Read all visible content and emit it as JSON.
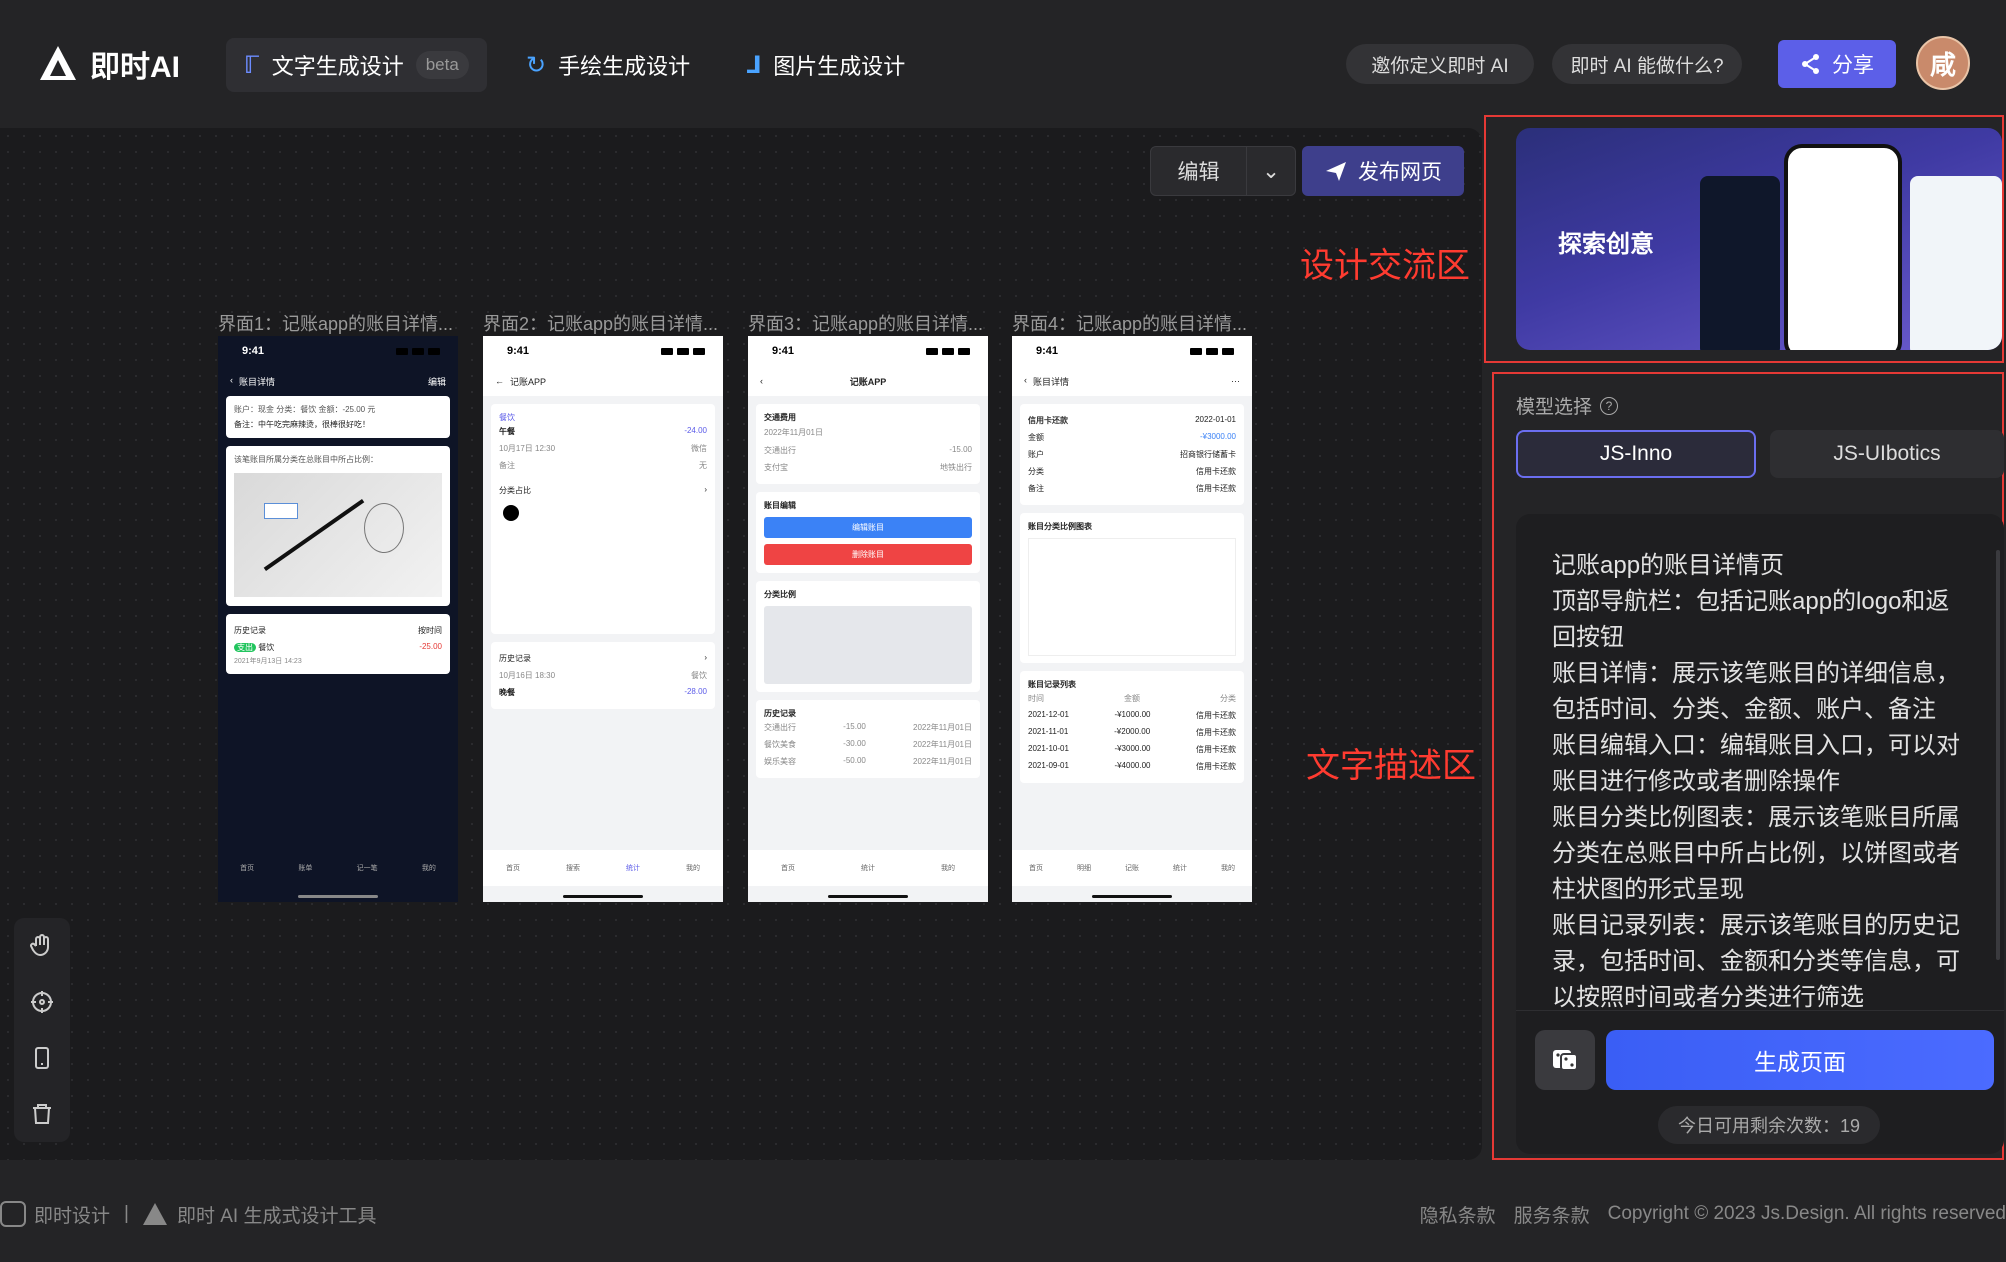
{
  "header": {
    "logo_text": "即时AI",
    "tabs": [
      {
        "label": "文字生成设计",
        "badge": "beta"
      },
      {
        "label": "手绘生成设计"
      },
      {
        "label": "图片生成设计"
      }
    ],
    "invite": "邀你定义即时 AI",
    "what_can": "即时 AI 能做什么?",
    "share": "分享",
    "avatar": "咸"
  },
  "canvas": {
    "edit": "编辑",
    "publish": "发布网页",
    "screens": [
      {
        "title": "界面1：记账app的账目详情..."
      },
      {
        "title": "界面2：记账app的账目详情..."
      },
      {
        "title": "界面3：记账app的账目详情..."
      },
      {
        "title": "界面4：记账app的账目详情..."
      }
    ],
    "phone1": {
      "time": "9:41",
      "title": "账目详情",
      "edit": "编辑",
      "info": "账户：现金  分类：餐饮  金额：-25.00 元",
      "note": "备注：中午吃完麻辣烫，很棒很好吃！",
      "chart_q": "该笔账目所属分类在总账目中所占比例：",
      "history": "历史记录",
      "sort": "按时间",
      "tag": "支出",
      "cat": "餐饮",
      "amt": "-25.00",
      "date": "2021年9月13日 14:23",
      "tabs": [
        "首页",
        "账单",
        "记一笔",
        "我的"
      ]
    },
    "phone2": {
      "time": "9:41",
      "title": "记账APP",
      "cat": "餐饮",
      "item": "午餐",
      "amt": "-24.00",
      "date": "10月17日 12:30",
      "note": "备注",
      "pay": "微信",
      "none": "无",
      "pie": "分类占比",
      "history": "历史记录",
      "date2": "10月16日 18:30",
      "cat2": "餐饮",
      "item2": "晚餐",
      "amt2": "-28.00",
      "tabs": [
        "首页",
        "搜索",
        "统计",
        "我的"
      ]
    },
    "phone3": {
      "time": "9:41",
      "title": "记账APP",
      "fee": "交通费用",
      "date": "2022年11月01日",
      "k1": "交通出行",
      "v1": "-15.00",
      "k2": "支付宝",
      "v2": "地铁出行",
      "edit": "账目编辑",
      "btn1": "编辑账目",
      "btn2": "删除账目",
      "ratio": "分类比例",
      "history": "历史记录",
      "rows": [
        [
          "交通出行",
          "-15.00",
          "2022年11月01日"
        ],
        [
          "餐饮美食",
          "-30.00",
          "2022年11月01日"
        ],
        [
          "娱乐美容",
          "-50.00",
          "2022年11月01日"
        ]
      ],
      "tabs": [
        "首页",
        "统计",
        "我的"
      ]
    },
    "phone4": {
      "time": "9:41",
      "title": "账目详情",
      "card": "信用卡还款",
      "date": "2022-01-01",
      "k1": "金额",
      "v1": "-¥3000.00",
      "k2": "账户",
      "v2": "招商银行储蓄卡",
      "k3": "分类",
      "v3": "信用卡还款",
      "k4": "备注",
      "v4": "信用卡还款",
      "chart": "账目分类比例图表",
      "list": "账目记录列表",
      "cols": [
        "时间",
        "金额",
        "分类"
      ],
      "rows": [
        [
          "2021-12-01",
          "-¥1000.00",
          "信用卡还款"
        ],
        [
          "2021-11-01",
          "-¥2000.00",
          "信用卡还款"
        ],
        [
          "2021-10-01",
          "-¥3000.00",
          "信用卡还款"
        ],
        [
          "2021-09-01",
          "-¥4000.00",
          "信用卡还款"
        ]
      ],
      "tabs": [
        "首页",
        "明细",
        "记账",
        "统计",
        "我的"
      ]
    }
  },
  "right": {
    "banner": "探索创意",
    "label1": "设计交流区",
    "label2": "文字描述区",
    "model_label": "模型选择",
    "model_a": "JS-Inno",
    "model_b": "JS-UIbotics",
    "description": "记账app的账目详情页\n顶部导航栏：包括记账app的logo和返回按钮\n账目详情：展示该笔账目的详细信息，包括时间、分类、金额、账户、备注\n账目编辑入口：编辑账目入口，可以对账目进行修改或者删除操作\n账目分类比例图表：展示该笔账目所属分类在总账目中所占比例，以饼图或者柱状图的形式呈现\n账目记录列表：展示该笔账目的历史记录，包括时间、金额和分类等信息，可以按照时间或者分类进行筛选",
    "generate": "生成页面",
    "remaining": "今日可用剩余次数：19"
  },
  "footer": {
    "brand1": "即时设计",
    "brand2": "即时 AI 生成式设计工具",
    "privacy": "隐私条款",
    "terms": "服务条款",
    "copyright": "Copyright © 2023 Js.Design. All rights reserved"
  }
}
